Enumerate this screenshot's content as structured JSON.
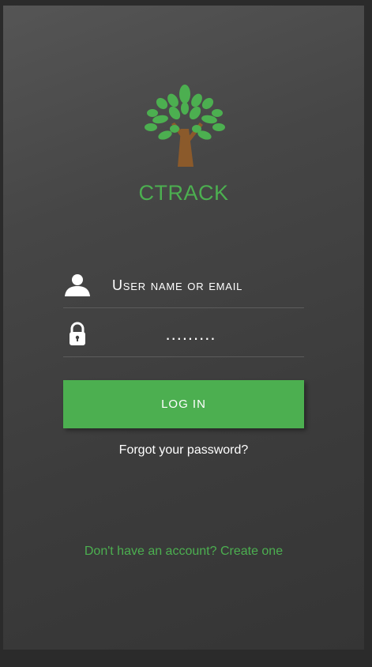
{
  "app": {
    "title": "CTRACK",
    "logo_icon": "tree-icon"
  },
  "login_form": {
    "username": {
      "icon": "user-icon",
      "placeholder": "User name or email",
      "value": ""
    },
    "password": {
      "icon": "lock-icon",
      "placeholder": "",
      "value": "........."
    },
    "login_label": "LOG IN",
    "forgot_label": "Forgot your password?"
  },
  "signup": {
    "label": "Don't have an account? Create one"
  },
  "colors": {
    "accent": "#4caf50",
    "trunk": "#8b5a2b",
    "background": "#404040"
  }
}
